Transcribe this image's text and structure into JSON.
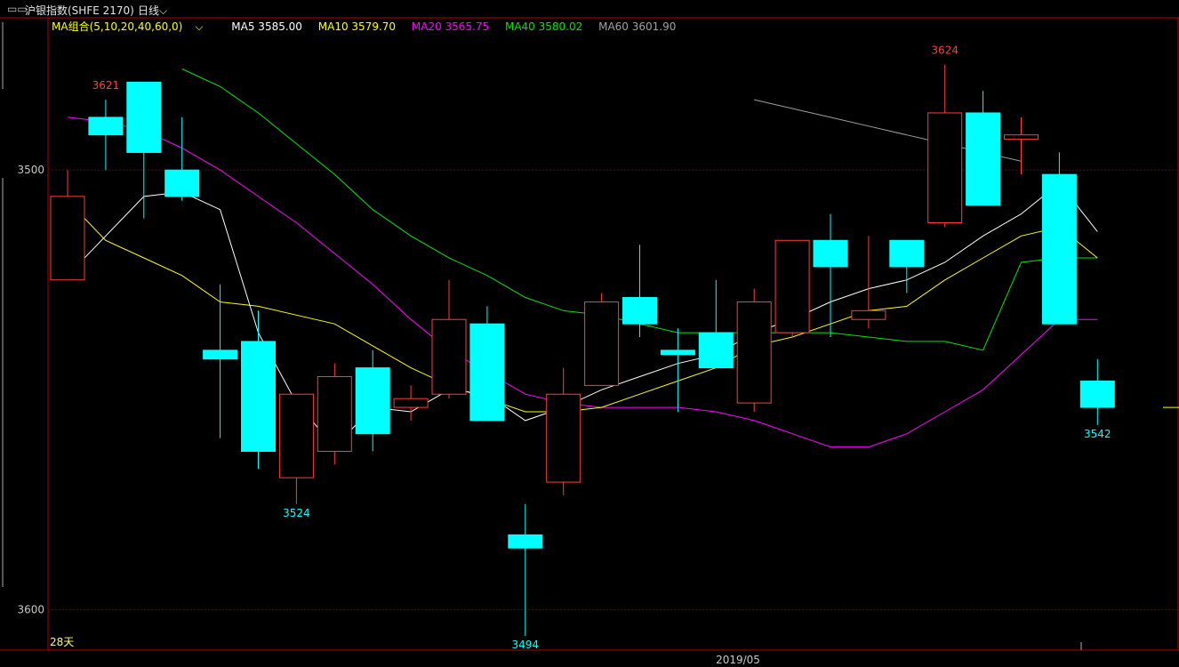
{
  "header": {
    "window_icon": "window-icon",
    "title": "沪银指数(SHFE 2170)",
    "period": "日线",
    "period_icon": "chevron-down-icon"
  },
  "ma_legend": {
    "group_label": "MA组合(5,10,20,40,60,0)",
    "group_icon": "chevron-down-icon",
    "items": [
      {
        "label": "MA5 3585.00",
        "color": "#ffffff"
      },
      {
        "label": "MA10 3579.70",
        "color": "#ffff00"
      },
      {
        "label": "MA20 3565.75",
        "color": "#ff00ff"
      },
      {
        "label": "MA40 3580.02",
        "color": "#00e600"
      },
      {
        "label": "MA60 3601.90",
        "color": "#a0a0a0"
      }
    ]
  },
  "colors": {
    "up": "#ff3c3c",
    "down": "#00ffff",
    "axis": "#b40000",
    "grid": "#6a0000",
    "text": "#c8c8c8"
  },
  "chart_data": {
    "type": "candlestick",
    "ylim": [
      3493,
      3631
    ],
    "yticks": [
      3500,
      3600
    ],
    "candles": [
      {
        "o": 3575,
        "h": 3600,
        "l": 3575,
        "c": 3594
      },
      {
        "o": 3612,
        "h": 3616,
        "l": 3600,
        "c": 3608
      },
      {
        "o": 3620,
        "h": 3620,
        "l": 3589,
        "c": 3604
      },
      {
        "o": 3600,
        "h": 3612,
        "l": 3593,
        "c": 3594
      },
      {
        "o": 3559,
        "h": 3574,
        "l": 3539,
        "c": 3557
      },
      {
        "o": 3561,
        "h": 3568,
        "l": 3532,
        "c": 3536
      },
      {
        "o": 3530,
        "h": 3547,
        "l": 3524,
        "c": 3549
      },
      {
        "o": 3536,
        "h": 3556,
        "l": 3533,
        "c": 3553
      },
      {
        "o": 3555,
        "h": 3559,
        "l": 3536,
        "c": 3540
      },
      {
        "o": 3546,
        "h": 3551,
        "l": 3543,
        "c": 3548
      },
      {
        "o": 3549,
        "h": 3575,
        "l": 3548,
        "c": 3566
      },
      {
        "o": 3565,
        "h": 3569,
        "l": 3543,
        "c": 3543
      },
      {
        "o": 3517,
        "h": 3524,
        "l": 3494,
        "c": 3514
      },
      {
        "o": 3529,
        "h": 3555,
        "l": 3526,
        "c": 3549
      },
      {
        "o": 3551,
        "h": 3572,
        "l": 3551,
        "c": 3570
      },
      {
        "o": 3571,
        "h": 3583,
        "l": 3562,
        "c": 3565
      },
      {
        "o": 3559,
        "h": 3564,
        "l": 3545,
        "c": 3558
      },
      {
        "o": 3563,
        "h": 3575,
        "l": 3555,
        "c": 3555
      },
      {
        "o": 3547,
        "h": 3573,
        "l": 3545,
        "c": 3570
      },
      {
        "o": 3563,
        "h": 3584,
        "l": 3562,
        "c": 3584
      },
      {
        "o": 3584,
        "h": 3590,
        "l": 3562,
        "c": 3578
      },
      {
        "o": 3566,
        "h": 3585,
        "l": 3564,
        "c": 3568
      },
      {
        "o": 3584,
        "h": 3580,
        "l": 3572,
        "c": 3578
      },
      {
        "o": 3588,
        "h": 3624,
        "l": 3587,
        "c": 3613
      },
      {
        "o": 3613,
        "h": 3618,
        "l": 3594,
        "c": 3592
      },
      {
        "o": 3607,
        "h": 3612,
        "l": 3599,
        "c": 3608
      },
      {
        "o": 3599,
        "h": 3604,
        "l": 3566,
        "c": 3565
      },
      {
        "o": 3552,
        "h": 3557,
        "l": 3542,
        "c": 3546
      }
    ],
    "ma5": [
      3576,
      3585,
      3594,
      3595,
      3591,
      3563,
      3547,
      3537,
      3546,
      3545,
      3550,
      3549,
      3543,
      3546,
      3550,
      3553,
      3556,
      3558,
      3563,
      3566,
      3570,
      3573,
      3575,
      3579,
      3585,
      3590,
      3597,
      3586
    ],
    "ma10": [
      3593,
      3584,
      3580,
      3576,
      3570,
      3569,
      3567,
      3565,
      3560,
      3555,
      3551,
      3548,
      3545,
      3545,
      3546,
      3549,
      3552,
      3555,
      3560,
      3562,
      3565,
      3568,
      3569,
      3575,
      3580,
      3585,
      3587,
      3580
    ],
    "ma20": [
      3612,
      3611,
      3609,
      3605,
      3600,
      3594,
      3588,
      3581,
      3574,
      3566,
      3559,
      3554,
      3549,
      3547,
      3546,
      3546,
      3546,
      3545,
      3543,
      3540,
      3537,
      3537,
      3540,
      3545,
      3550,
      3558,
      3566,
      3566
    ],
    "ma40": [
      3623,
      3619,
      3613,
      3606,
      3599,
      3591,
      3585,
      3580,
      3576,
      3571,
      3568,
      3567,
      3565,
      3563,
      3563,
      3563,
      3563,
      3563,
      3562,
      3561,
      3561,
      3559,
      3579,
      3580,
      3580
    ],
    "ma60": [
      3616,
      3614,
      3612,
      3610,
      3608,
      3606,
      3604,
      3602
    ],
    "marks": [
      {
        "index": 1,
        "text": "3621",
        "color": "up",
        "pos": "top"
      },
      {
        "index": 6,
        "text": "3524",
        "color": "down",
        "pos": "bottom"
      },
      {
        "index": 12,
        "text": "3494",
        "color": "down",
        "pos": "bottom"
      },
      {
        "index": 23,
        "text": "3624",
        "color": "up",
        "pos": "top"
      },
      {
        "index": 27,
        "text": "3542",
        "color": "down",
        "pos": "bottom"
      }
    ],
    "ytick_labels": [
      "3600",
      "3500"
    ],
    "bars_count_label": "28天",
    "x_label": "2019/05"
  }
}
